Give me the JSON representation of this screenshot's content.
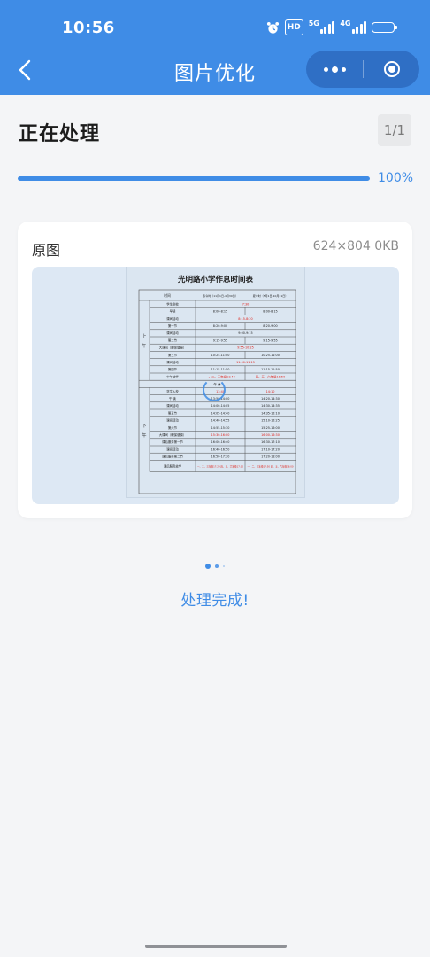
{
  "status_bar": {
    "time": "10:56",
    "hd_label": "HD",
    "net_5g": "5G",
    "net_4g": "4G"
  },
  "nav": {
    "title": "图片优化"
  },
  "processing": {
    "title": "正在处理",
    "page_counter": "1/1",
    "progress_percent": 100,
    "progress_text": "100%"
  },
  "card": {
    "label": "原图",
    "meta": "624×804 0KB"
  },
  "thumbnail": {
    "title": "光明路小学作息时间表",
    "header_cols": [
      "时间",
      "冬令时（11月1日-4月30日）",
      "夏令时（5月1日-10月31日）"
    ],
    "morning_label": [
      "上",
      "午"
    ],
    "afternoon_label": [
      "下",
      "午"
    ],
    "noon_divider": "午  休",
    "morning_rows": [
      {
        "name": "学生到校",
        "winter": "7:30",
        "summer": "",
        "merged": true
      },
      {
        "name": "早读",
        "winter": "8:00-8:15",
        "summer": "8:00-8:15"
      },
      {
        "name": "课间活动",
        "winter": "8:15-8:20",
        "summer": "",
        "merged": true
      },
      {
        "name": "第一节",
        "winter": "8:20-9:00",
        "summer": "8:20-9:00"
      },
      {
        "name": "课间活动",
        "winter": "9:00-9:15",
        "summer": "",
        "merged": true
      },
      {
        "name": "第二节",
        "winter": "9:15-9:55",
        "summer": "9:15-9:55"
      },
      {
        "name": "大课间（眼保健操）",
        "winter": "9:55-10:25",
        "summer": "",
        "merged": true
      },
      {
        "name": "第三节",
        "winter": "10:25-11:00",
        "summer": "10:25-11:00"
      },
      {
        "name": "课间活动",
        "winter": "11:00-11:15",
        "summer": "",
        "merged": true
      },
      {
        "name": "第四节",
        "winter": "11:15-11:50",
        "summer": "11:15-11:50"
      },
      {
        "name": "中午放学",
        "winter": "一、二、三年级11:40",
        "summer": "四、五、六年级11:50"
      }
    ],
    "afternoon_rows": [
      {
        "name": "学生入校",
        "winter": "13:40",
        "summer": "14:10"
      },
      {
        "name": "午  读",
        "winter": "13:50-14:00",
        "summer": "14:20-14:30"
      },
      {
        "name": "课间活动",
        "winter": "14:00-14:05",
        "summer": "14:30-14:35"
      },
      {
        "name": "第五节",
        "winter": "14:05-14:40",
        "summer": "14:35-15:10"
      },
      {
        "name": "课间活动",
        "winter": "14:40-14:55",
        "summer": "15:10-15:25"
      },
      {
        "name": "第六节",
        "winter": "14:55-15:30",
        "summer": "15:25-16:00"
      },
      {
        "name": "大课间（眼保健操）",
        "winter": "15:30-16:00",
        "summer": "16:00-16:30"
      },
      {
        "name": "课后服务第一节",
        "winter": "16:00-16:40",
        "summer": "16:30-17:10"
      },
      {
        "name": "课间活动",
        "winter": "16:40-16:50",
        "summer": "17:10-17:20"
      },
      {
        "name": "课后服务第二节",
        "winter": "16:50-17:30",
        "summer": "17:20-18:00"
      },
      {
        "name": "课后服务放学",
        "winter": "一、二、三年级17:20 四、五、六年级17:30",
        "summer": "一、二、三年级17:50 四、五、六年级18:00"
      }
    ]
  },
  "completion": {
    "text": "处理完成!"
  },
  "colors": {
    "primary": "#3f8ce6",
    "capsule": "#2f6fc5",
    "background": "#f4f5f7",
    "highlight_red": "#e0241c"
  }
}
